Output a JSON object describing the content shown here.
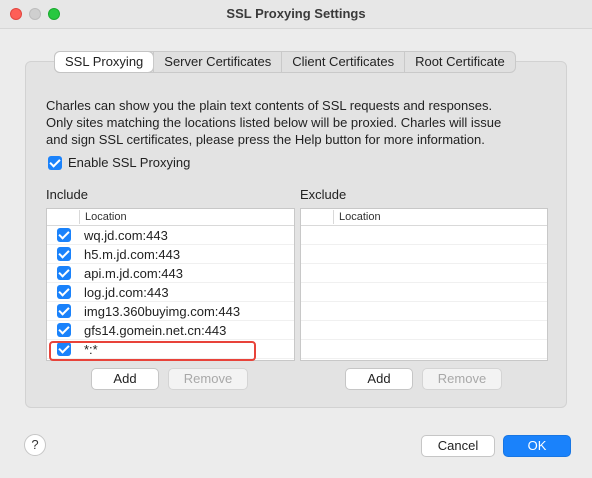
{
  "window": {
    "title": "SSL Proxying Settings"
  },
  "tabs": [
    {
      "label": "SSL Proxying",
      "active": true
    },
    {
      "label": "Server Certificates",
      "active": false
    },
    {
      "label": "Client Certificates",
      "active": false
    },
    {
      "label": "Root Certificate",
      "active": false
    }
  ],
  "description": {
    "line1": "Charles can show you the plain text contents of SSL requests and responses.",
    "line2": "Only sites matching the locations listed below will be proxied. Charles will issue",
    "line3": "and sign SSL certificates, please press the Help button for more information."
  },
  "enable_ssl": {
    "label": "Enable SSL Proxying",
    "checked": true
  },
  "include": {
    "label": "Include",
    "column_header": "Location",
    "rows": [
      {
        "location": "wq.jd.com:443",
        "checked": true
      },
      {
        "location": "h5.m.jd.com:443",
        "checked": true
      },
      {
        "location": "api.m.jd.com:443",
        "checked": true
      },
      {
        "location": "log.jd.com:443",
        "checked": true
      },
      {
        "location": "img13.360buyimg.com:443",
        "checked": true
      },
      {
        "location": "gfs14.gomein.net.cn:443",
        "checked": true
      },
      {
        "location": "*:*",
        "checked": true
      }
    ],
    "add_label": "Add",
    "remove_label": "Remove"
  },
  "exclude": {
    "label": "Exclude",
    "column_header": "Location",
    "rows": [],
    "add_label": "Add",
    "remove_label": "Remove"
  },
  "footer": {
    "help_label": "?",
    "cancel_label": "Cancel",
    "ok_label": "OK"
  },
  "colors": {
    "accent": "#1a82fb",
    "highlight": "#e8433a"
  }
}
